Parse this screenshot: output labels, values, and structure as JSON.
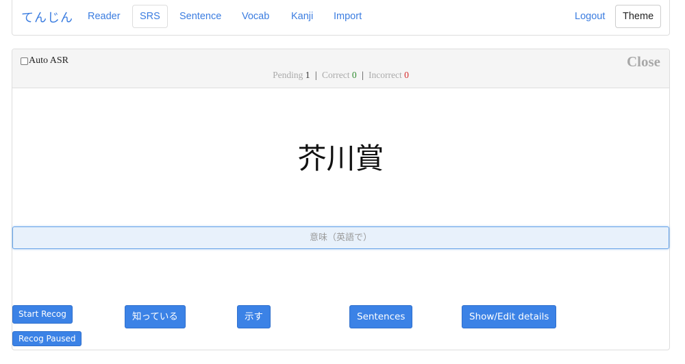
{
  "navbar": {
    "brand": "てんじん",
    "links": [
      "Reader",
      "SRS",
      "Sentence",
      "Vocab",
      "Kanji",
      "Import"
    ],
    "active_link": "SRS",
    "logout": "Logout",
    "theme": "Theme"
  },
  "review": {
    "auto_asr_label": "Auto ASR",
    "auto_asr_checked": false,
    "close_label": "Close",
    "stats": {
      "pending_label": "Pending",
      "pending": "1",
      "correct_label": "Correct",
      "correct": "0",
      "incorrect_label": "Incorrect",
      "incorrect": "0"
    },
    "word": "芥川賞",
    "answer_placeholder": "意味（英語で）",
    "answer_value": "",
    "buttons": {
      "start_recog": "Start Recog",
      "recog_paused": "Recog Paused",
      "know": "知っている",
      "show": "示す",
      "sentences": "Sentences",
      "show_edit_details": "Show/Edit details"
    }
  },
  "colors": {
    "accent": "#3b82e6",
    "correct": "#2e8b2e",
    "incorrect": "#d62b2b"
  }
}
